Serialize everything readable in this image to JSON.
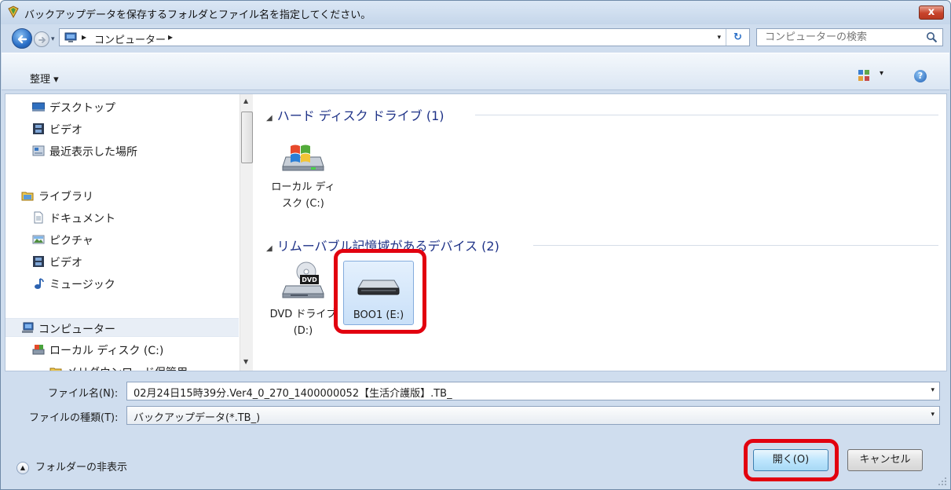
{
  "window": {
    "title": "バックアップデータを保存するフォルダとファイル名を指定してください。",
    "close_label": "x"
  },
  "navbar": {
    "crumb_separator": "▸",
    "address": "コンピューター",
    "dropdown_arrow": "▾",
    "refresh_glyph": "↻",
    "search_placeholder": "コンピューターの検索"
  },
  "command_bar": {
    "organize_label": "整理 ▾",
    "view_menu_arrow": "▾",
    "help_glyph": "?"
  },
  "nav_pane": {
    "items": [
      {
        "label": "デスクトップ",
        "icon": "desktop-icon"
      },
      {
        "label": "ビデオ",
        "icon": "video-icon"
      },
      {
        "label": "最近表示した場所",
        "icon": "recent-places-icon"
      },
      {
        "label": "ライブラリ",
        "icon": "library-icon"
      },
      {
        "label": "ドキュメント",
        "icon": "document-icon"
      },
      {
        "label": "ピクチャ",
        "icon": "picture-icon"
      },
      {
        "label": "ビデオ",
        "icon": "video-icon"
      },
      {
        "label": "ミュージック",
        "icon": "music-icon"
      },
      {
        "label": "コンピューター",
        "icon": "computer-icon"
      },
      {
        "label": "ローカル ディスク (C:)",
        "icon": "local-disk-icon"
      },
      {
        "label": "メリダウンロード保管用",
        "icon": "folder-icon"
      }
    ]
  },
  "content": {
    "groups": [
      {
        "header": "ハード ディスク ドライブ (1)",
        "drives": [
          {
            "label": "ローカル ディスク (C:)",
            "icon": "windows-drive-icon"
          }
        ]
      },
      {
        "header": "リムーバブル記憶域があるデバイス (2)",
        "drives": [
          {
            "label": "DVD ドライブ (D:)",
            "icon": "dvd-drive-icon"
          },
          {
            "label": "BOO1 (E:)",
            "icon": "removable-drive-icon"
          }
        ]
      }
    ],
    "dvd_badge": "DVD"
  },
  "bottom": {
    "filename_label": "ファイル名(N):",
    "filename_value": "02月24日15時39分.Ver4_0_270_1400000052【生活介護版】.TB_",
    "filetype_label": "ファイルの種類(T):",
    "filetype_value": "バックアップデータ(*.TB_)",
    "hide_folders_label": "フォルダーの非表示",
    "open_button": "開く(O)",
    "cancel_button": "キャンセル"
  },
  "colors": {
    "highlight": "#e2000f",
    "group_header": "#1e3287"
  }
}
